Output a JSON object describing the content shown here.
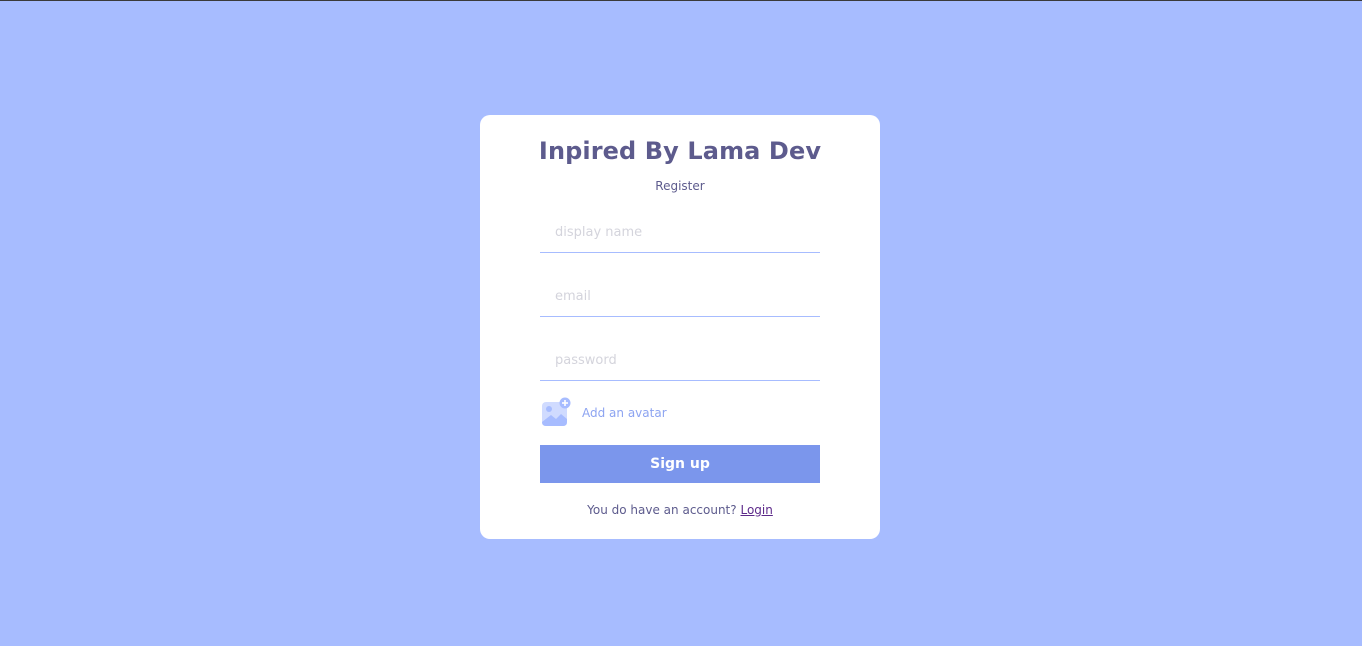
{
  "form": {
    "logo": "Inpired By Lama Dev",
    "title": "Register",
    "display_name_placeholder": "display name",
    "email_placeholder": "email",
    "password_placeholder": "password",
    "avatar_label": "Add an avatar",
    "avatar_icon": "add-image-icon",
    "submit_label": "Sign up",
    "footer_text": "You do have an account?",
    "login_link": "Login"
  },
  "colors": {
    "background": "#a7bcff",
    "card": "#ffffff",
    "primary_text": "#5d5b8d",
    "button": "#7b96ec",
    "input_border": "#a7bcff"
  }
}
